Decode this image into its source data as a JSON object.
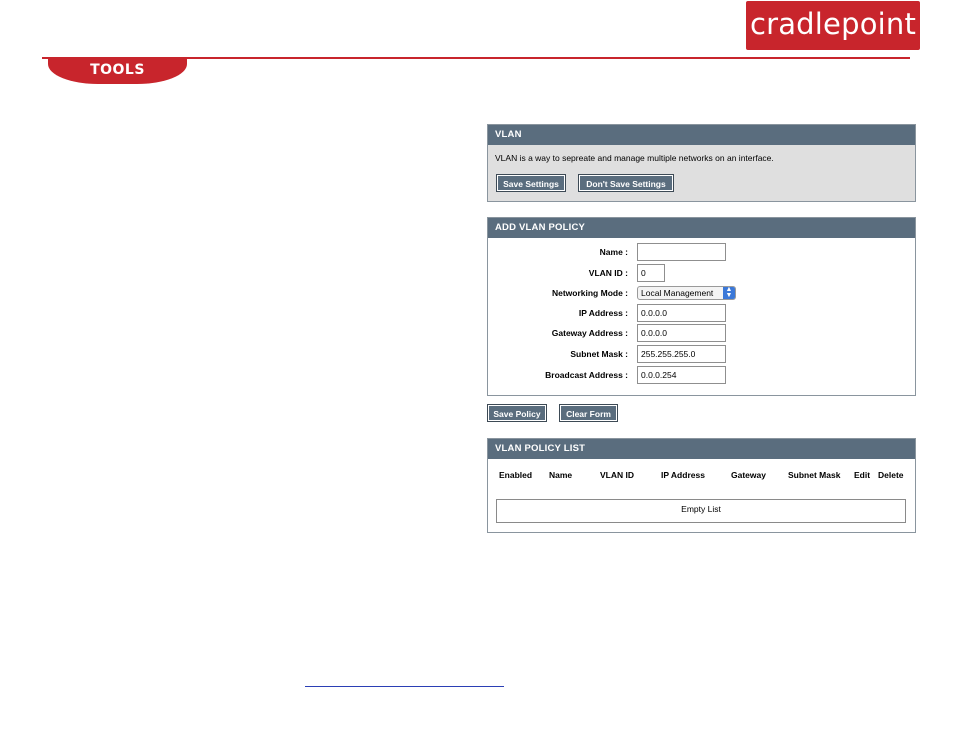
{
  "header": {
    "brand": "cradlepoint",
    "section_tab": "TOOLS",
    "brand_color": "#c8252c"
  },
  "vlan_panel": {
    "title": "VLAN",
    "description": "VLAN is a way to sepreate and manage multiple networks on an interface.",
    "save_label": "Save Settings",
    "dont_save_label": "Don't Save Settings"
  },
  "add_policy": {
    "title": "ADD VLAN POLICY",
    "fields": {
      "name": {
        "label": "Name :",
        "value": ""
      },
      "vlan_id": {
        "label": "VLAN ID :",
        "value": "0"
      },
      "networking_mode": {
        "label": "Networking Mode :",
        "value": "Local Management"
      },
      "ip_address": {
        "label": "IP Address :",
        "value": "0.0.0.0"
      },
      "gateway": {
        "label": "Gateway Address :",
        "value": "0.0.0.0"
      },
      "subnet_mask": {
        "label": "Subnet Mask :",
        "value": "255.255.255.0"
      },
      "broadcast": {
        "label": "Broadcast Address :",
        "value": "0.0.0.254"
      }
    },
    "save_policy_label": "Save Policy",
    "clear_form_label": "Clear Form"
  },
  "policy_list": {
    "title": "VLAN POLICY LIST",
    "columns": [
      "Enabled",
      "Name",
      "VLAN ID",
      "IP Address",
      "Gateway",
      "Subnet Mask",
      "Edit",
      "Delete"
    ],
    "empty_text": "Empty List"
  },
  "colors": {
    "panel_header": "#5a6d7e",
    "panel_bg": "#dfdfdf",
    "accent_red": "#c8252c"
  }
}
